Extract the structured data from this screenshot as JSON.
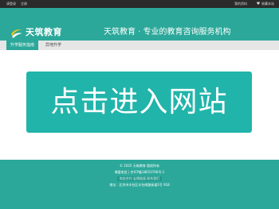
{
  "topbar": {
    "login": "请登录",
    "register": "注册",
    "home": "我的资料",
    "favorite": "收藏本站",
    "favorite_icon": "heart-icon"
  },
  "header": {
    "logo_text": "天筑教育",
    "slogan": "天筑教育 · 专业的教育咨询服务机构",
    "logo_icon": "swoosh-logo-icon"
  },
  "nav": {
    "active": "升学服务指南",
    "other": "异地升学"
  },
  "banner": {
    "text": "点击进入网站"
  },
  "footer": {
    "copyright": "© 2025 天筑教育 版权所有",
    "icp": "增值电信 | 京ICP备18053766号-1",
    "links": "商务合作  友情链接  联系我们",
    "address": "地址：北京市丰台区丰台南路街道1号 918"
  },
  "colors": {
    "brand": "#2ba89a",
    "banner": "#21b4aa",
    "topbar": "#2b2b2b"
  }
}
